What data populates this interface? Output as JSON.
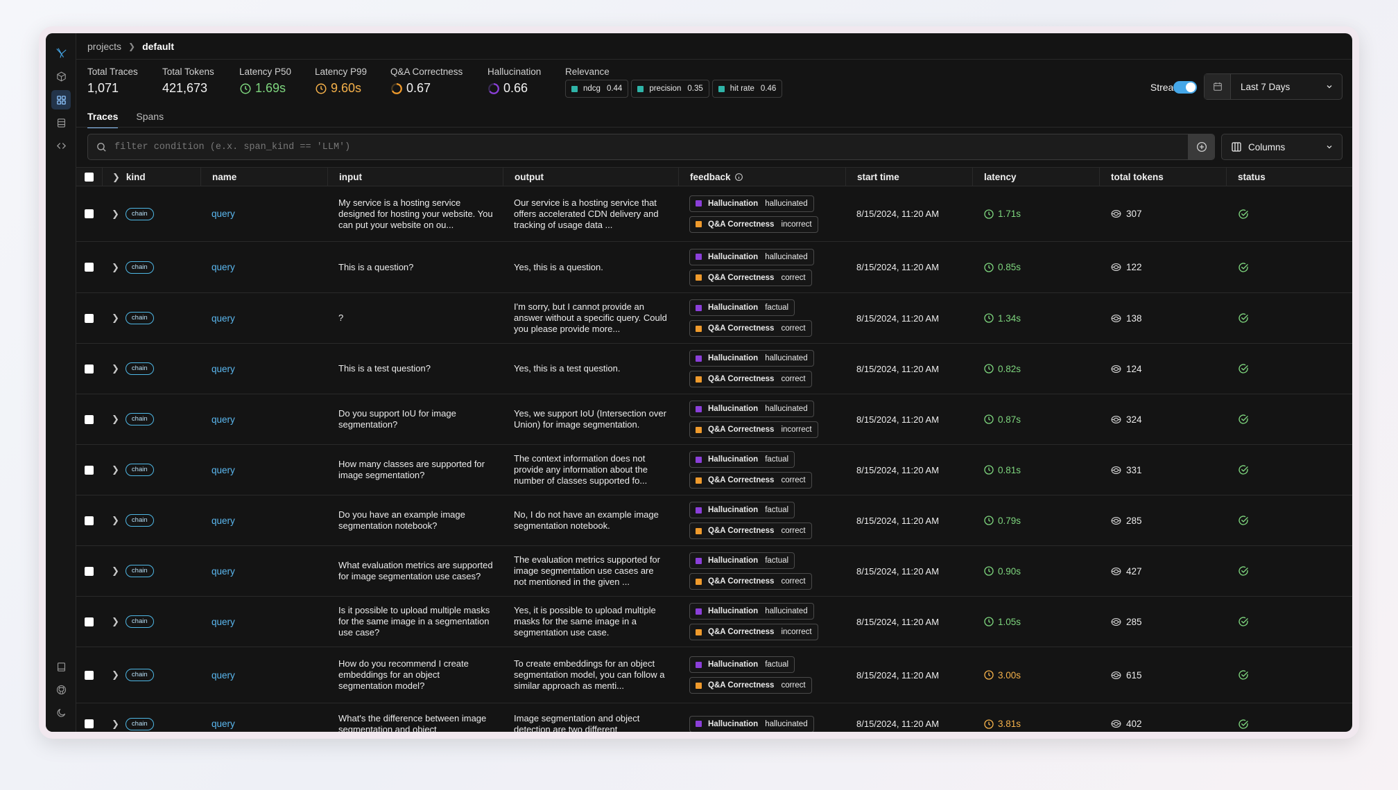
{
  "breadcrumb": {
    "root": "projects",
    "current": "default"
  },
  "stats": {
    "total_traces": {
      "label": "Total Traces",
      "value": "1,071"
    },
    "total_tokens": {
      "label": "Total Tokens",
      "value": "421,673"
    },
    "latency_p50": {
      "label": "Latency P50",
      "value": "1.69s"
    },
    "latency_p99": {
      "label": "Latency P99",
      "value": "9.60s"
    },
    "qa_correctness": {
      "label": "Q&A Correctness",
      "value": "0.67"
    },
    "hallucination": {
      "label": "Hallucination",
      "value": "0.66"
    },
    "relevance": {
      "label": "Relevance",
      "chips": [
        {
          "name": "ndcg",
          "value": "0.44"
        },
        {
          "name": "precision",
          "value": "0.35"
        },
        {
          "name": "hit rate",
          "value": "0.46"
        }
      ]
    }
  },
  "stream": {
    "label": "Stream",
    "enabled": true
  },
  "date_range": {
    "value": "Last 7 Days"
  },
  "tabs": [
    {
      "label": "Traces",
      "active": true
    },
    {
      "label": "Spans",
      "active": false
    }
  ],
  "filter": {
    "placeholder": "filter condition (e.x. span_kind == 'LLM')",
    "value": ""
  },
  "columns_button": {
    "label": "Columns"
  },
  "table": {
    "headers": {
      "kind": "kind",
      "name": "name",
      "input": "input",
      "output": "output",
      "feedback": "feedback",
      "start_time": "start time",
      "latency": "latency",
      "total_tokens": "total tokens",
      "status": "status"
    },
    "rows": [
      {
        "kind": "chain",
        "name": "query",
        "input": "My service is a hosting service designed for hosting your website. You can put your website on ou...",
        "output": "Our service is a hosting service that offers accelerated CDN delivery and tracking of usage data ...",
        "hallucination": "hallucinated",
        "qa": "incorrect",
        "start_time": "8/15/2024, 11:20 AM",
        "latency": "1.71s",
        "latency_level": "ok",
        "tokens": "307"
      },
      {
        "kind": "chain",
        "name": "query",
        "input": "This is a question?",
        "output": "Yes, this is a question.",
        "hallucination": "hallucinated",
        "qa": "correct",
        "start_time": "8/15/2024, 11:20 AM",
        "latency": "0.85s",
        "latency_level": "ok",
        "tokens": "122"
      },
      {
        "kind": "chain",
        "name": "query",
        "input": "?",
        "output": "I'm sorry, but I cannot provide an answer without a specific query. Could you please provide more...",
        "hallucination": "factual",
        "qa": "correct",
        "start_time": "8/15/2024, 11:20 AM",
        "latency": "1.34s",
        "latency_level": "ok",
        "tokens": "138"
      },
      {
        "kind": "chain",
        "name": "query",
        "input": "This is a test question?",
        "output": "Yes, this is a test question.",
        "hallucination": "hallucinated",
        "qa": "correct",
        "start_time": "8/15/2024, 11:20 AM",
        "latency": "0.82s",
        "latency_level": "ok",
        "tokens": "124"
      },
      {
        "kind": "chain",
        "name": "query",
        "input": "Do you support IoU for image segmentation?",
        "output": "Yes, we support IoU (Intersection over Union) for image segmentation.",
        "hallucination": "hallucinated",
        "qa": "incorrect",
        "start_time": "8/15/2024, 11:20 AM",
        "latency": "0.87s",
        "latency_level": "ok",
        "tokens": "324"
      },
      {
        "kind": "chain",
        "name": "query",
        "input": "How many classes are supported for image segmentation?",
        "output": "The context information does not provide any information about the number of classes supported fo...",
        "hallucination": "factual",
        "qa": "correct",
        "start_time": "8/15/2024, 11:20 AM",
        "latency": "0.81s",
        "latency_level": "ok",
        "tokens": "331"
      },
      {
        "kind": "chain",
        "name": "query",
        "input": "Do you have an example image segmentation notebook?",
        "output": "No, I do not have an example image segmentation notebook.",
        "hallucination": "factual",
        "qa": "correct",
        "start_time": "8/15/2024, 11:20 AM",
        "latency": "0.79s",
        "latency_level": "ok",
        "tokens": "285"
      },
      {
        "kind": "chain",
        "name": "query",
        "input": "What evaluation metrics are supported for image segmentation use cases?",
        "output": "The evaluation metrics supported for image segmentation use cases are not mentioned in the given ...",
        "hallucination": "factual",
        "qa": "correct",
        "start_time": "8/15/2024, 11:20 AM",
        "latency": "0.90s",
        "latency_level": "ok",
        "tokens": "427"
      },
      {
        "kind": "chain",
        "name": "query",
        "input": "Is it possible to upload multiple masks for the same image in a segmentation use case?",
        "output": "Yes, it is possible to upload multiple masks for the same image in a segmentation use case.",
        "hallucination": "hallucinated",
        "qa": "incorrect",
        "start_time": "8/15/2024, 11:20 AM",
        "latency": "1.05s",
        "latency_level": "ok",
        "tokens": "285"
      },
      {
        "kind": "chain",
        "name": "query",
        "input": "How do you recommend I create embeddings for an object segmentation model?",
        "output": "To create embeddings for an object segmentation model, you can follow a similar approach as menti...",
        "hallucination": "factual",
        "qa": "correct",
        "start_time": "8/15/2024, 11:20 AM",
        "latency": "3.00s",
        "latency_level": "warn",
        "tokens": "615"
      },
      {
        "kind": "chain",
        "name": "query",
        "input": "What's the difference between image segmentation and object",
        "output": "Image segmentation and object detection are two different",
        "hallucination": "hallucinated",
        "qa": "",
        "start_time": "8/15/2024, 11:20 AM",
        "latency": "3.81s",
        "latency_level": "warn",
        "tokens": "402"
      }
    ]
  },
  "feedback_labels": {
    "hallucination": "Hallucination",
    "qa": "Q&A Correctness"
  },
  "colors": {
    "hallucination_swatch": "#8b3fd9",
    "qa_swatch": "#ef9a2c",
    "relevance_swatch": "#2fb4a8",
    "latency_ok": "#7ed67e",
    "latency_warn": "#f5b14a",
    "link": "#5bb8f0",
    "accent": "#45a7e8"
  },
  "icons": {
    "sidebar_top": [
      "bird-logo-icon",
      "cube-icon",
      "grid-icon",
      "database-icon",
      "code-icon"
    ],
    "sidebar_bottom": [
      "book-icon",
      "github-icon",
      "moon-icon"
    ],
    "latency": "clock-icon",
    "tokens": "token-icon",
    "status": "check-circle-icon"
  }
}
